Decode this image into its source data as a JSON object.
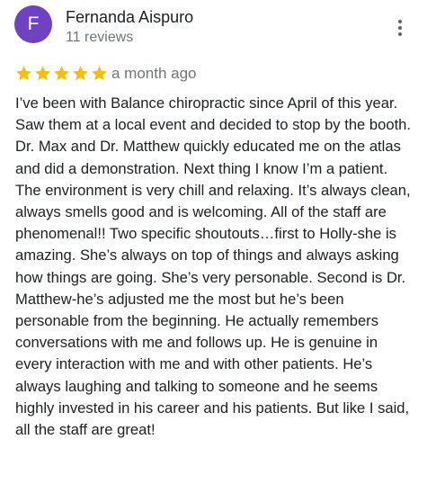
{
  "review": {
    "avatar_letter": "F",
    "avatar_color": "#6f42c1",
    "reviewer_name": "Fernanda Aispuro",
    "review_count": "11 reviews",
    "rating": 5,
    "rating_max": 5,
    "star_color": "#fbbc04",
    "date": "a month ago",
    "text": "I’ve been with Balance chiropractic since April of this year. Saw them at a local event and decided to stop by the booth. Dr. Max and Dr. Matthew quickly educated me on the atlas and did a demonstration. Next thing I know I’m a patient. The environment is very chill and relaxing. It’s always clean, always smells good and is welcoming. All of the staff are phenomenal!! Two specific shoutouts…first to Holly-she is amazing. She’s always on top of things and always asking how things are going. She’s very personable. Second is Dr. Matthew-he’s adjusted me the most but he’s been personable from the beginning. He actually remembers conversations with me and follows up. He is genuine in every interaction with me and with other patients. He’s always laughing and talking to someone and he seems highly invested in his career and his patients. But like I said, all the staff are great!",
    "more_menu_icon": "more-vert-icon"
  }
}
